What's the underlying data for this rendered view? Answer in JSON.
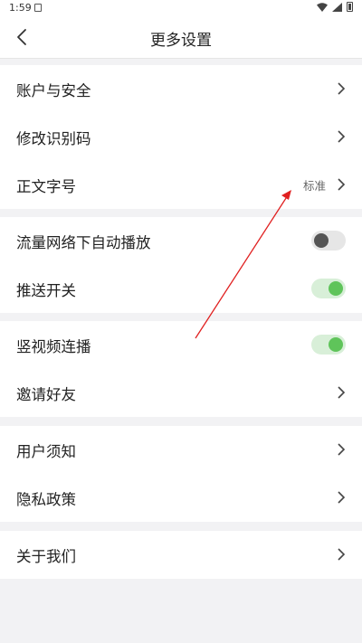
{
  "status_bar": {
    "time": "1:59"
  },
  "header": {
    "title": "更多设置"
  },
  "groups": [
    {
      "items": [
        {
          "label": "账户与安全"
        },
        {
          "label": "修改识别码"
        },
        {
          "label": "正文字号",
          "value": "标准"
        }
      ]
    },
    {
      "items": [
        {
          "label": "流量网络下自动播放",
          "toggle": "off"
        },
        {
          "label": "推送开关",
          "toggle": "on"
        }
      ]
    },
    {
      "items": [
        {
          "label": "竖视频连播",
          "toggle": "on"
        },
        {
          "label": "邀请好友"
        }
      ]
    },
    {
      "items": [
        {
          "label": "用户须知"
        },
        {
          "label": "隐私政策"
        }
      ]
    },
    {
      "items": [
        {
          "label": "关于我们"
        }
      ]
    }
  ],
  "colors": {
    "toggle_on": "#5fc45a",
    "annotation_arrow": "#e02020"
  }
}
